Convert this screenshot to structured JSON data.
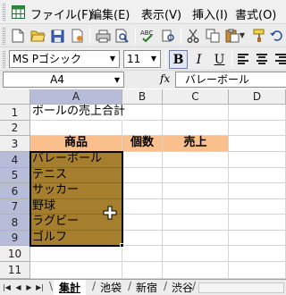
{
  "menubar": {
    "items": [
      "ファイル(F)",
      "編集(E)",
      "表示(V)",
      "挿入(I)",
      "書式(O)"
    ]
  },
  "format_toolbar": {
    "font_name": "MS Pゴシック",
    "font_size": "11",
    "bold_label": "B",
    "italic_label": "I",
    "underline_label": "U"
  },
  "formula_bar": {
    "name_box": "A4",
    "fx_label": "fx",
    "content": "バレーボール"
  },
  "grid": {
    "columns": [
      "A",
      "B",
      "C",
      "D"
    ],
    "selected_column": "A",
    "rows": [
      "1",
      "2",
      "3",
      "4",
      "5",
      "6",
      "7",
      "8",
      "9",
      "10",
      "11"
    ],
    "selected_rows": [
      "4",
      "5",
      "6",
      "7",
      "8",
      "9"
    ],
    "cells": {
      "A1": "ボールの売上合計",
      "A3": "商品",
      "B3": "個数",
      "C3": "売上",
      "A4": "バレーボール",
      "A5": "テニス",
      "A6": "サッカー",
      "A7": "野球",
      "A8": "ラグビー",
      "A9": "ゴルフ"
    },
    "selection": "A4:A9",
    "colors": {
      "header_fill": "#f9bf8c",
      "selection_fill": "#a57f2d",
      "header_highlight": "#b7bdd8"
    }
  },
  "sheet_tabs": {
    "tabs": [
      "集計",
      "池袋",
      "新宿",
      "渋谷"
    ],
    "active": "集計"
  }
}
